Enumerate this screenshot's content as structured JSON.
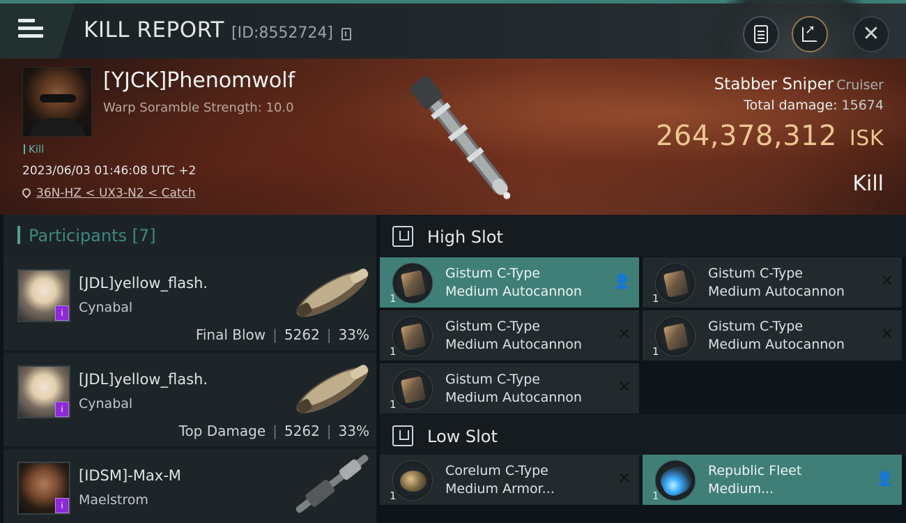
{
  "header": {
    "title": "KILL REPORT",
    "report_id": "[ID:8552724]"
  },
  "victim": {
    "name": "[YJCK]Phenomwolf",
    "scramble": "Warp Soramble Strength: 10.0",
    "kill_tag": "Kill",
    "datetime": "2023/06/03 01:46:08 UTC +2",
    "location": "36N-HZ < UX3-N2 < Catch",
    "ship": "Stabber Sniper",
    "ship_class": "Cruiser",
    "damage_label": "Total damage:",
    "damage_value": "15674",
    "isk_value": "264,378,312",
    "isk_unit": "ISK",
    "result": "Kill"
  },
  "participants": {
    "label": "Participants [7]",
    "items": [
      {
        "name": "[JDL]yellow_flash.",
        "ship": "Cynabal",
        "role": "Final Blow",
        "damage": "5262",
        "percent": "33%"
      },
      {
        "name": "[JDL]yellow_flash.",
        "ship": "Cynabal",
        "role": "Top Damage",
        "damage": "5262",
        "percent": "33%"
      },
      {
        "name": "[IDSM]-Max-M",
        "ship": "Maelstrom",
        "role": "",
        "damage": "",
        "percent": ""
      }
    ],
    "badge_glyph": "i"
  },
  "slots": {
    "high": {
      "label": "High Slot",
      "modules": [
        {
          "line1": "Gistum C-Type",
          "line2": "Medium Autocannon",
          "qty": "1",
          "state": "dropped",
          "state_glyph": "👤"
        },
        {
          "line1": "Gistum C-Type",
          "line2": "Medium Autocannon",
          "qty": "1",
          "state": "destroyed",
          "state_glyph": "✕"
        },
        {
          "line1": "Gistum C-Type",
          "line2": "Medium Autocannon",
          "qty": "1",
          "state": "destroyed",
          "state_glyph": "✕"
        },
        {
          "line1": "Gistum C-Type",
          "line2": "Medium Autocannon",
          "qty": "1",
          "state": "destroyed",
          "state_glyph": "✕"
        },
        {
          "line1": "Gistum C-Type",
          "line2": "Medium Autocannon",
          "qty": "1",
          "state": "destroyed",
          "state_glyph": "✕"
        }
      ]
    },
    "low": {
      "label": "Low Slot",
      "modules": [
        {
          "line1": "Corelum C-Type",
          "line2": "Medium Armor...",
          "qty": "1",
          "state": "destroyed",
          "state_glyph": "✕"
        },
        {
          "line1": "Republic Fleet",
          "line2": "Medium...",
          "qty": "1",
          "state": "dropped",
          "state_glyph": "👤"
        }
      ]
    }
  },
  "colors": {
    "accent": "#3f7f78",
    "isk": "#ebc690",
    "badge": "#8c2bd6"
  }
}
